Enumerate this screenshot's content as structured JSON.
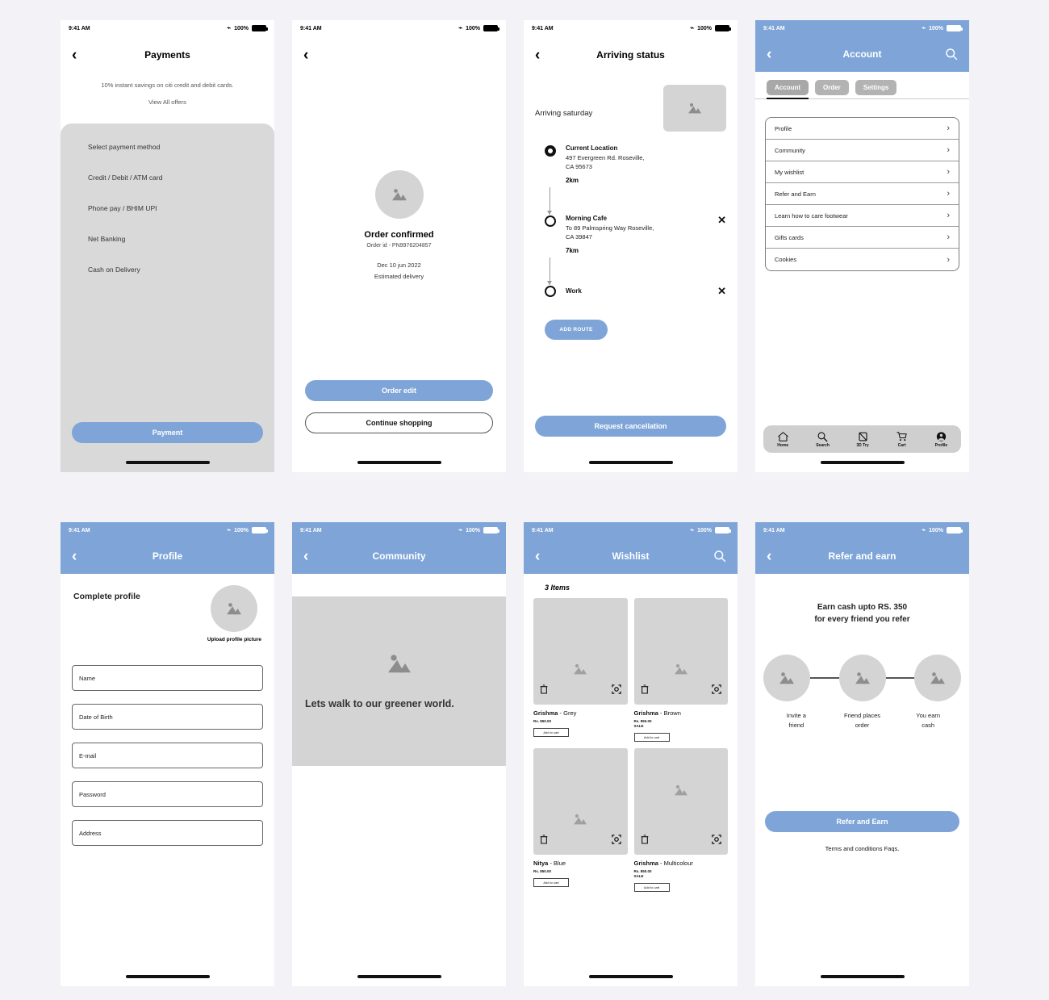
{
  "status_bar": {
    "time": "9:41 AM",
    "battery": "100%",
    "bluetooth_icon": "bluetooth-icon"
  },
  "screens": {
    "payments": {
      "title": "Payments",
      "offer": "10% instant savings on citi credit and debit cards.",
      "view_all": "View All offers",
      "section_label": "Select payment method",
      "methods": [
        "Credit / Debit / ATM card",
        "Phone pay / BHIM UPI",
        "Net Banking",
        "Cash on Delivery"
      ],
      "cta": "Payment"
    },
    "order_confirmed": {
      "title": "Order confirmed",
      "order_id": "Order id - PN9976204857",
      "date": "Dec 10 jun 2022",
      "estimated": "Estimated delivery",
      "primary_cta": "Order edit",
      "secondary_cta": "Continue shopping"
    },
    "arriving": {
      "title": "Arriving status",
      "arriving_text": "Arriving saturday",
      "stops": [
        {
          "name": "Current Location",
          "address_line1": "497 Evergreen Rd. Roseville,",
          "address_line2": "CA 95673",
          "distance": "2km",
          "closable": false
        },
        {
          "name": "Morning Cafe",
          "address_line1": "To 89 Palmspring Way Roseville,",
          "address_line2": "CA 39847",
          "distance": "7km",
          "closable": true
        },
        {
          "name": "Work",
          "address_line1": "",
          "address_line2": "",
          "distance": "",
          "closable": true
        }
      ],
      "add_route": "ADD ROUTE",
      "cancel_cta": "Request cancellation"
    },
    "account": {
      "title": "Account",
      "search_icon": "search-icon",
      "tabs": [
        {
          "label": "Account",
          "active": true
        },
        {
          "label": "Order",
          "active": false
        },
        {
          "label": "Settings",
          "active": false
        }
      ],
      "rows": [
        "Profile",
        "Community",
        "My wishlist",
        "Refer and Earn",
        "Learn how to care footwear",
        "Gifts cards",
        "Cookies"
      ],
      "bottom_nav": [
        {
          "label": "Home",
          "icon": "home-icon"
        },
        {
          "label": "Search",
          "icon": "search-icon"
        },
        {
          "label": "3D Try",
          "icon": "3d-try-icon"
        },
        {
          "label": "Cart",
          "icon": "cart-icon"
        },
        {
          "label": "Profile",
          "icon": "profile-icon"
        }
      ]
    },
    "profile": {
      "title": "Profile",
      "heading": "Complete profile",
      "upload_label": "Upload profile picture",
      "fields": [
        {
          "label": "Name",
          "value": ""
        },
        {
          "label": "Date of Birth",
          "value": ""
        },
        {
          "label": "E-mail",
          "value": ""
        },
        {
          "label": "Password",
          "value": ""
        },
        {
          "label": "Address",
          "value": ""
        }
      ]
    },
    "community": {
      "title": "Community",
      "card_text": "Lets walk to our greener world."
    },
    "wishlist": {
      "title": "Wishlist",
      "search_icon": "search-icon",
      "count": "3 Items",
      "items": [
        {
          "brand": "Grishma",
          "variant": "- Grey",
          "price": "Rs. 850.00",
          "sale": "",
          "add_to_cart": "Add to cart"
        },
        {
          "brand": "Grishma",
          "variant": "- Brown",
          "price": "Rs. 850.00",
          "sale": "SALE",
          "add_to_cart": "Add to cart"
        },
        {
          "brand": "Nitya",
          "variant": "- Blue",
          "price": "Rs. 850.00",
          "sale": "",
          "add_to_cart": "Add to cart"
        },
        {
          "brand": "Grishma",
          "variant": "- Multicolour",
          "price": "Rs. 850.00",
          "sale": "SALE",
          "add_to_cart": "Add to cart"
        }
      ]
    },
    "refer": {
      "title": "Refer and earn",
      "headline_line1": "Earn cash upto RS. 350",
      "headline_line2": "for every friend you refer",
      "steps": [
        {
          "line1": "Invite a",
          "line2": "friend"
        },
        {
          "line1": "Friend places",
          "line2": "order"
        },
        {
          "line1": "You earn",
          "line2": "cash"
        }
      ],
      "cta": "Refer and Earn",
      "terms": "Terms and conditions Faqs."
    }
  },
  "colors": {
    "accent_blue": "#7fa5d8",
    "placeholder_grey": "#d4d4d4",
    "panel_grey": "#d9d9d9"
  }
}
